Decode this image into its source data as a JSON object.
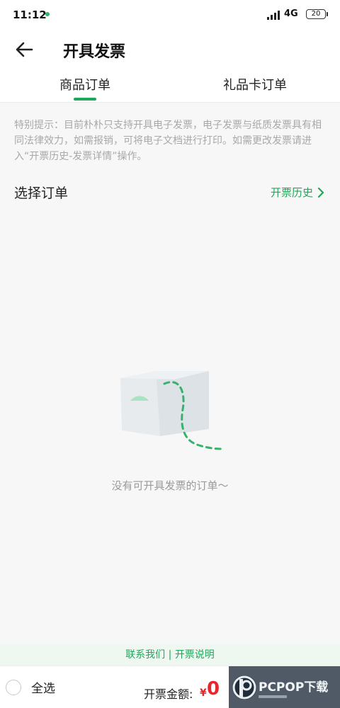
{
  "status_bar": {
    "time": "11:12",
    "network": "4G",
    "battery": "20"
  },
  "header": {
    "title": "开具发票"
  },
  "tabs": [
    {
      "label": "商品订单",
      "active": true
    },
    {
      "label": "礼品卡订单",
      "active": false
    }
  ],
  "notice": {
    "text": "特别提示：目前朴朴只支持开具电子发票，电子发票与纸质发票具有相同法律效力，如需报销，可将电子文档进行打印。如需更改发票请进入“开票历史-发票详情”操作。"
  },
  "section": {
    "title": "选择订单",
    "history_link": "开票历史"
  },
  "empty_state": {
    "message": "没有可开具发票的订单～"
  },
  "help": {
    "contact": "联系我们",
    "separator": " | ",
    "explanation": "开票说明"
  },
  "bottom_bar": {
    "select_all_label": "全选",
    "amount_label": "开票金额:",
    "currency": "¥",
    "amount": "0"
  },
  "watermark": {
    "text": "PCPOP下载"
  },
  "colors": {
    "accent": "#1fa85a",
    "price": "#e5262e"
  },
  "icons": {
    "back": "arrow-left-icon",
    "history_chevron": "chevron-right-icon",
    "empty_box": "empty-box-icon"
  }
}
